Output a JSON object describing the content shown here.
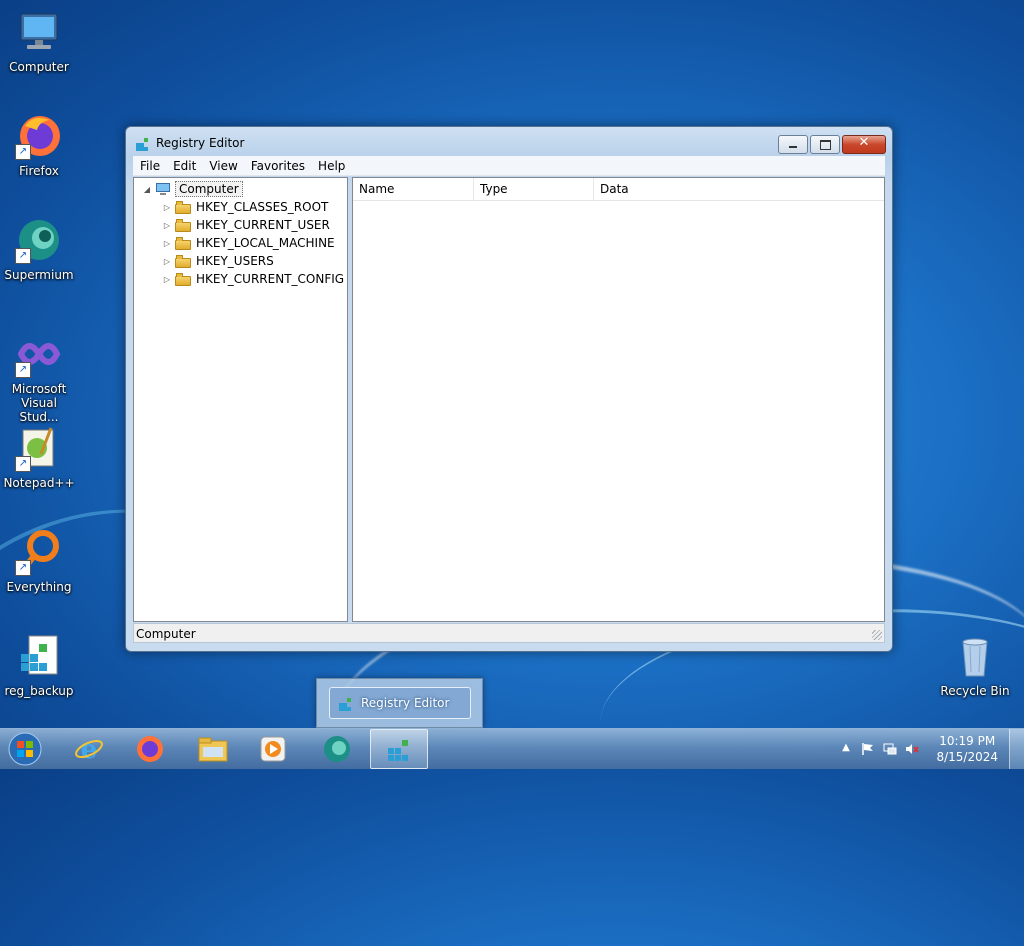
{
  "desktop": {
    "icons": [
      {
        "label": "Computer"
      },
      {
        "label": "Firefox"
      },
      {
        "label": "Supermium"
      },
      {
        "label": "Microsoft Visual Stud..."
      },
      {
        "label": "Notepad++"
      },
      {
        "label": "Everything"
      },
      {
        "label": "reg_backup"
      },
      {
        "label": "Recycle Bin"
      }
    ]
  },
  "window": {
    "title": "Registry Editor",
    "menu": [
      "File",
      "Edit",
      "View",
      "Favorites",
      "Help"
    ],
    "tree": {
      "root": "Computer",
      "children": [
        "HKEY_CLASSES_ROOT",
        "HKEY_CURRENT_USER",
        "HKEY_LOCAL_MACHINE",
        "HKEY_USERS",
        "HKEY_CURRENT_CONFIG"
      ]
    },
    "list_columns": [
      "Name",
      "Type",
      "Data"
    ],
    "status": "Computer"
  },
  "taskbar_popup": {
    "label": "Registry Editor"
  },
  "clock": {
    "time": "10:19 PM",
    "date": "8/15/2024"
  },
  "colors": {
    "accent": "#1b6fc4",
    "window_frame": "#b9d1ea"
  }
}
